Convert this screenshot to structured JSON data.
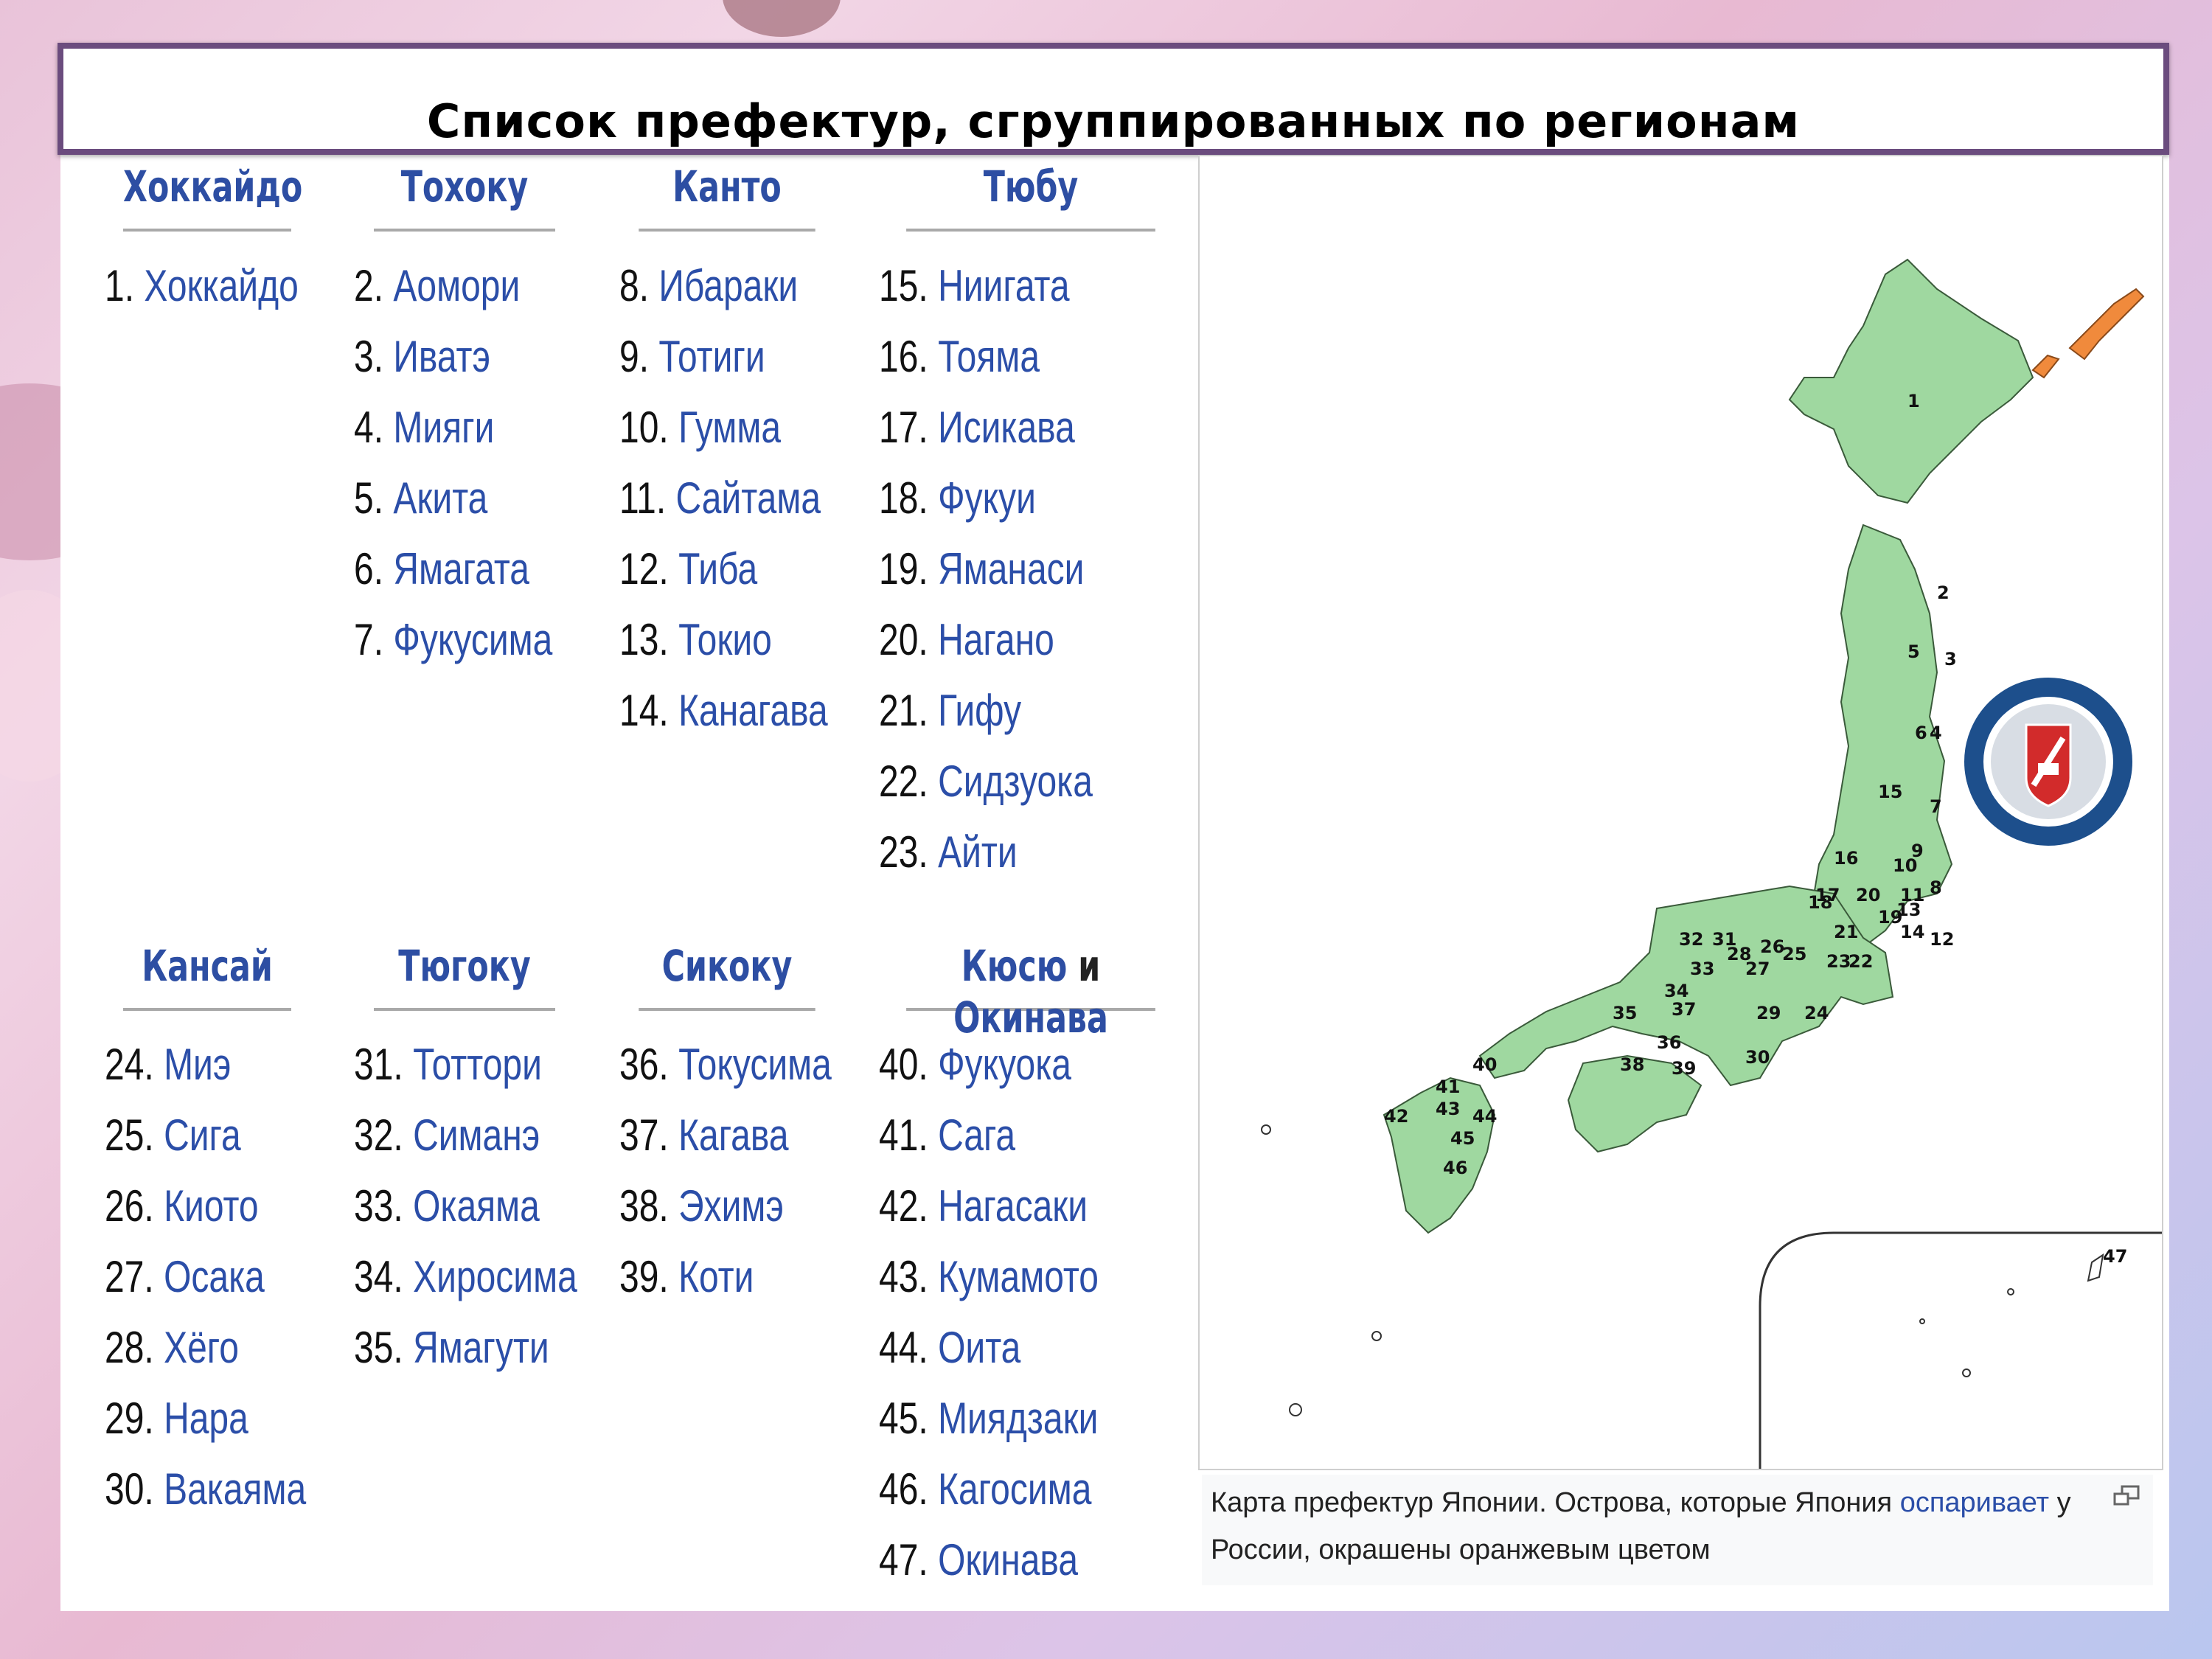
{
  "title": "Список префектур, сгруппированных по регионам",
  "colors": {
    "link": "#2b4ea8",
    "header_border": "#6b4c7e",
    "map_fill": "#9fd8a0",
    "disputed": "#f08a3c"
  },
  "regions": [
    {
      "name": "Хоккайдо",
      "prefectures": [
        {
          "num": "1.",
          "name": "Хоккайдо"
        }
      ]
    },
    {
      "name": "Тохоку",
      "prefectures": [
        {
          "num": "2.",
          "name": "Аомори"
        },
        {
          "num": "3.",
          "name": "Иватэ"
        },
        {
          "num": "4.",
          "name": "Мияги"
        },
        {
          "num": "5.",
          "name": "Акита"
        },
        {
          "num": "6.",
          "name": "Ямагата"
        },
        {
          "num": "7.",
          "name": "Фукусима"
        }
      ]
    },
    {
      "name": "Канто",
      "prefectures": [
        {
          "num": "8.",
          "name": "Ибараки"
        },
        {
          "num": "9.",
          "name": "Тотиги"
        },
        {
          "num": "10.",
          "name": "Гумма"
        },
        {
          "num": "11.",
          "name": "Сайтама"
        },
        {
          "num": "12.",
          "name": "Тиба"
        },
        {
          "num": "13.",
          "name": "Токио"
        },
        {
          "num": "14.",
          "name": "Канагава"
        }
      ]
    },
    {
      "name": "Тюбу",
      "prefectures": [
        {
          "num": "15.",
          "name": "Ниигата"
        },
        {
          "num": "16.",
          "name": "Тояма"
        },
        {
          "num": "17.",
          "name": "Исикава"
        },
        {
          "num": "18.",
          "name": "Фукуи"
        },
        {
          "num": "19.",
          "name": "Яманаси"
        },
        {
          "num": "20.",
          "name": "Нагано"
        },
        {
          "num": "21.",
          "name": "Гифу"
        },
        {
          "num": "22.",
          "name": "Сидзуока"
        },
        {
          "num": "23.",
          "name": "Айти"
        }
      ]
    },
    {
      "name": "Кансай",
      "prefectures": [
        {
          "num": "24.",
          "name": "Миэ"
        },
        {
          "num": "25.",
          "name": "Сига"
        },
        {
          "num": "26.",
          "name": "Киото"
        },
        {
          "num": "27.",
          "name": "Осака"
        },
        {
          "num": "28.",
          "name": "Хёго"
        },
        {
          "num": "29.",
          "name": "Нара"
        },
        {
          "num": "30.",
          "name": "Вакаяма"
        }
      ]
    },
    {
      "name": "Тюгоку",
      "prefectures": [
        {
          "num": "31.",
          "name": "Тоттори"
        },
        {
          "num": "32.",
          "name": "Симанэ"
        },
        {
          "num": "33.",
          "name": "Окаяма"
        },
        {
          "num": "34.",
          "name": "Хиросима"
        },
        {
          "num": "35.",
          "name": "Ямагути"
        }
      ]
    },
    {
      "name": "Сикоку",
      "prefectures": [
        {
          "num": "36.",
          "name": "Токусима"
        },
        {
          "num": "37.",
          "name": "Кагава"
        },
        {
          "num": "38.",
          "name": "Эхимэ"
        },
        {
          "num": "39.",
          "name": "Коти"
        }
      ]
    },
    {
      "name_parts": [
        "Кюсю",
        "и",
        "Окинава"
      ],
      "prefectures": [
        {
          "num": "40.",
          "name": "Фукуока"
        },
        {
          "num": "41.",
          "name": "Сага"
        },
        {
          "num": "42.",
          "name": "Нагасаки"
        },
        {
          "num": "43.",
          "name": "Кумамото"
        },
        {
          "num": "44.",
          "name": "Оита"
        },
        {
          "num": "45.",
          "name": "Миядзаки"
        },
        {
          "num": "46.",
          "name": "Кагосима"
        },
        {
          "num": "47.",
          "name": "Окинава"
        }
      ]
    }
  ],
  "map_labels": [
    "1",
    "2",
    "3",
    "4",
    "5",
    "6",
    "7",
    "8",
    "9",
    "10",
    "11",
    "12",
    "13",
    "14",
    "15",
    "16",
    "17",
    "18",
    "19",
    "20",
    "21",
    "22",
    "23",
    "24",
    "25",
    "26",
    "27",
    "28",
    "29",
    "30",
    "31",
    "32",
    "33",
    "34",
    "35",
    "36",
    "37",
    "38",
    "39",
    "40",
    "41",
    "42",
    "43",
    "44",
    "45",
    "46",
    "47"
  ],
  "caption": {
    "part1": "Карта префектур Японии. Острова, которые Япония ",
    "link": "оспаривает",
    "part2": " у",
    "line2": "России, окрашены оранжевым цветом"
  }
}
